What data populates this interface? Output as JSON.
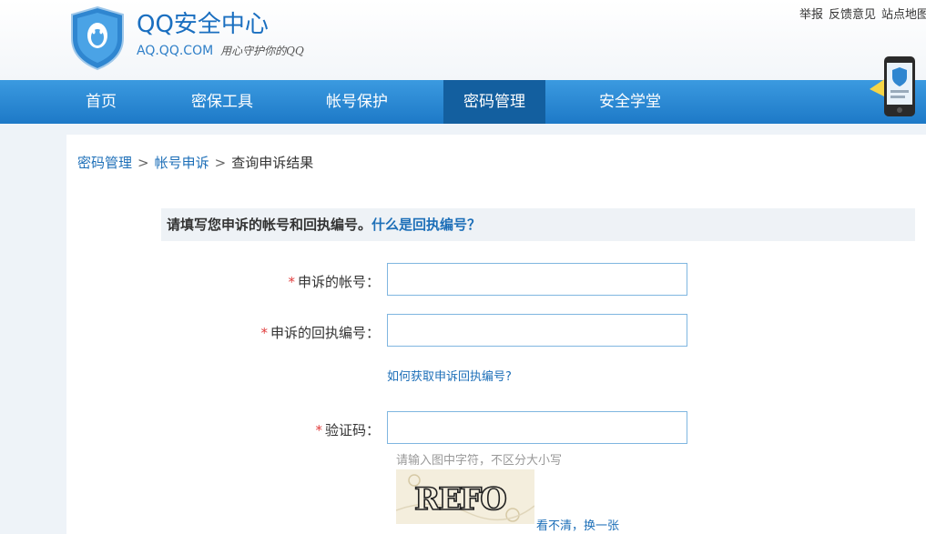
{
  "header": {
    "brand_title": "QQ安全中心",
    "brand_domain": "AQ.QQ.COM",
    "brand_slogan": "用心守护你的QQ",
    "top_links": [
      "举报",
      "反馈意见",
      "站点地图"
    ]
  },
  "nav": {
    "items": [
      {
        "label": "首页"
      },
      {
        "label": "密保工具"
      },
      {
        "label": "帐号保护"
      },
      {
        "label": "密码管理"
      },
      {
        "label": "安全学堂"
      }
    ],
    "active_label": "密码管理"
  },
  "breadcrumb": {
    "items": [
      "密码管理",
      "帐号申诉",
      "查询申诉结果"
    ],
    "separator": ">"
  },
  "notice": {
    "text": "请填写您申诉的帐号和回执编号。",
    "help_link": "什么是回执编号？"
  },
  "form": {
    "required_mark": "*",
    "account_label": "申诉的帐号：",
    "account_value": "",
    "receipt_label": "申诉的回执编号：",
    "receipt_value": "",
    "receipt_help": "如何获取申诉回执编号?",
    "captcha_label": "验证码：",
    "captcha_value": "",
    "captcha_hint": "请输入图中字符，不区分大小写",
    "captcha_text": "REFO",
    "refresh_link": "看不清，换一张"
  },
  "colors": {
    "nav_blue": "#2b8ad6",
    "nav_active": "#135f9f",
    "link_blue": "#1d6fb8",
    "required_red": "#e03c3c",
    "input_border": "#7fb6e0"
  }
}
